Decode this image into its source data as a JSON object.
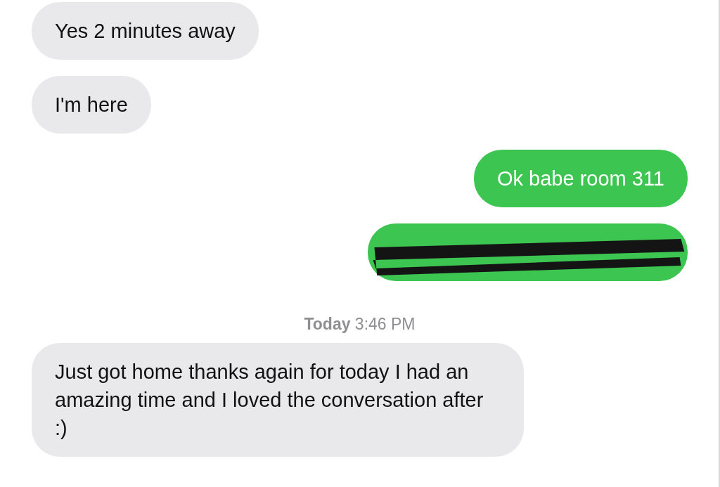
{
  "messages": [
    {
      "kind": "received",
      "text": "Yes 2 minutes away"
    },
    {
      "kind": "received",
      "text": "I'm here"
    },
    {
      "kind": "sent",
      "text": "Ok babe room 311"
    },
    {
      "kind": "redacted"
    },
    {
      "kind": "timestamp",
      "text": "**Today** 3:46 PM"
    },
    {
      "kind": "received",
      "text": "Just got home thanks again for today I had an amazing time and I loved the conversation after :)"
    }
  ]
}
